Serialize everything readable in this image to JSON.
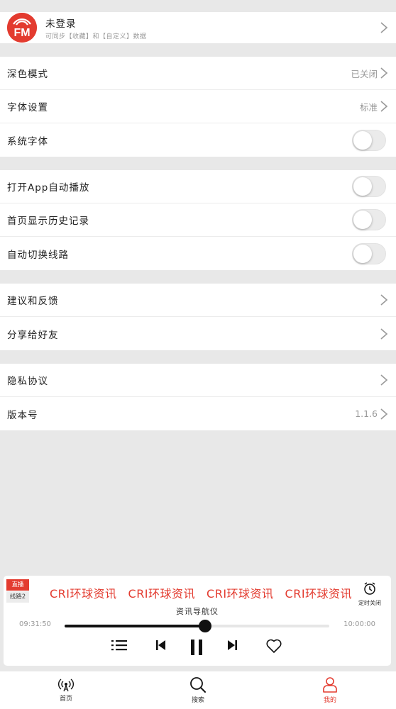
{
  "profile": {
    "logo_text": "FM",
    "name": "未登录",
    "subtitle": "可同步【收藏】和【自定义】数据"
  },
  "group1": {
    "dark_mode": {
      "label": "深色模式",
      "value": "已关闭"
    },
    "font_settings": {
      "label": "字体设置",
      "value": "标准"
    },
    "system_font": {
      "label": "系统字体",
      "enabled": false
    }
  },
  "group2": {
    "autoplay": {
      "label": "打开App自动播放",
      "enabled": false
    },
    "history": {
      "label": "首页显示历史记录",
      "enabled": false
    },
    "auto_switch": {
      "label": "自动切换线路",
      "enabled": false
    }
  },
  "group3": {
    "feedback": {
      "label": "建议和反馈"
    },
    "share": {
      "label": "分享给好友"
    }
  },
  "group4": {
    "privacy": {
      "label": "隐私协议"
    },
    "version": {
      "label": "版本号",
      "value": "1.1.6"
    }
  },
  "player": {
    "live_badge": "直播",
    "line_badge": "线路2",
    "station_ticker": [
      "CRI环球资讯",
      "CRI环球资讯",
      "CRI环球资讯",
      "CRI环球资讯"
    ],
    "timer_label": "定时关闭",
    "program": "资讯导航仪",
    "current_time": "09:31:50",
    "total_time": "10:00:00",
    "progress": 0.53,
    "accent_color": "#e33b2f",
    "controls": [
      "playlist-icon",
      "previous-icon",
      "pause-icon",
      "next-icon",
      "heart-icon"
    ]
  },
  "nav": {
    "home": "首页",
    "search": "搜索",
    "mine": "我的",
    "active": "mine"
  }
}
